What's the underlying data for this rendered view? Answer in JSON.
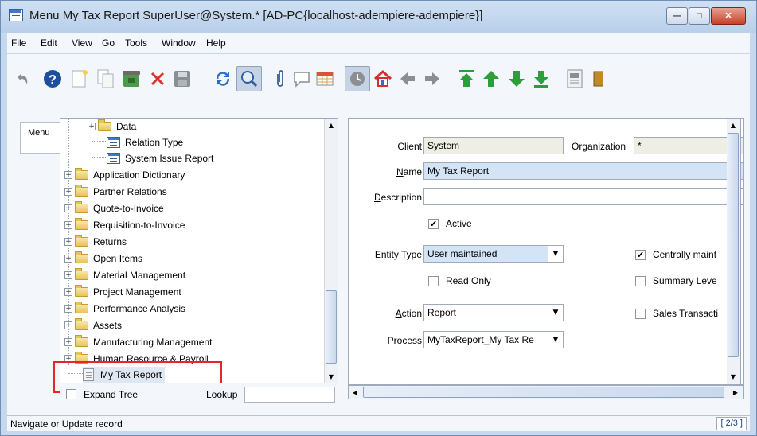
{
  "window": {
    "title": "Menu  My Tax Report  SuperUser@System.* [AD-PC{localhost-adempiere-adempiere}]"
  },
  "menubar": {
    "items": [
      "File",
      "Edit",
      "View",
      "Go",
      "Tools",
      "Window",
      "Help"
    ]
  },
  "toolbar": {
    "icons": [
      "undo-icon",
      "help-icon",
      "new-record-icon",
      "copy-record-icon",
      "delete-record-icon",
      "delete-selection-icon",
      "save-icon",
      "refresh-icon",
      "find-icon",
      "attachment-icon",
      "chat-icon",
      "grid-toggle-icon",
      "history-icon",
      "home-icon",
      "back-icon",
      "forward-icon",
      "first-record-icon",
      "previous-record-icon",
      "next-record-icon",
      "last-record-icon",
      "report-icon",
      "archive-icon"
    ]
  },
  "left_tab": {
    "label": "Menu"
  },
  "tree": {
    "items": [
      {
        "label": "Data",
        "type": "folder",
        "expander": "+"
      },
      {
        "label": "Relation Type",
        "type": "window"
      },
      {
        "label": "System Issue Report",
        "type": "window"
      },
      {
        "label": "Application Dictionary",
        "type": "folder",
        "expander": "+"
      },
      {
        "label": "Partner Relations",
        "type": "folder",
        "expander": "+"
      },
      {
        "label": "Quote-to-Invoice",
        "type": "folder",
        "expander": "+"
      },
      {
        "label": "Requisition-to-Invoice",
        "type": "folder",
        "expander": "+"
      },
      {
        "label": "Returns",
        "type": "folder",
        "expander": "+"
      },
      {
        "label": "Open Items",
        "type": "folder",
        "expander": "+"
      },
      {
        "label": "Material Management",
        "type": "folder",
        "expander": "+"
      },
      {
        "label": "Project Management",
        "type": "folder",
        "expander": "+"
      },
      {
        "label": "Performance Analysis",
        "type": "folder",
        "expander": "+"
      },
      {
        "label": "Assets",
        "type": "folder",
        "expander": "+"
      },
      {
        "label": "Manufacturing Management",
        "type": "folder",
        "expander": "+"
      },
      {
        "label": "Human Resource & Payroll",
        "type": "folder",
        "expander": "+"
      },
      {
        "label": "My Tax Report",
        "type": "report",
        "selected": true
      }
    ]
  },
  "tree_footer": {
    "expand_label": "Expand Tree",
    "lookup_label": "Lookup",
    "lookup_value": ""
  },
  "form": {
    "client_label": "Client",
    "client_value": "System",
    "org_label": "Organization",
    "org_value": "*",
    "name_label": "Name",
    "name_value": "My Tax Report",
    "description_label": "Description",
    "description_value": "",
    "active_label": "Active",
    "active_checked": true,
    "entity_label": "Entity Type",
    "entity_value": "User maintained",
    "centrally_label": "Centrally maint",
    "centrally_checked": true,
    "readonly_label": "Read Only",
    "readonly_checked": false,
    "summary_label": "Summary Leve",
    "summary_checked": false,
    "action_label": "Action",
    "action_value": "Report",
    "sales_label": "Sales Transacti",
    "sales_checked": false,
    "process_label": "Process",
    "process_value": "MyTaxReport_My Tax Re"
  },
  "status": {
    "text": "Navigate or Update record",
    "record": "[ 2/3 ]"
  },
  "colors": {
    "mandatory_field": "#d4e4f7",
    "readonly_field": "#eeeee4",
    "highlight": "#e8252b"
  }
}
